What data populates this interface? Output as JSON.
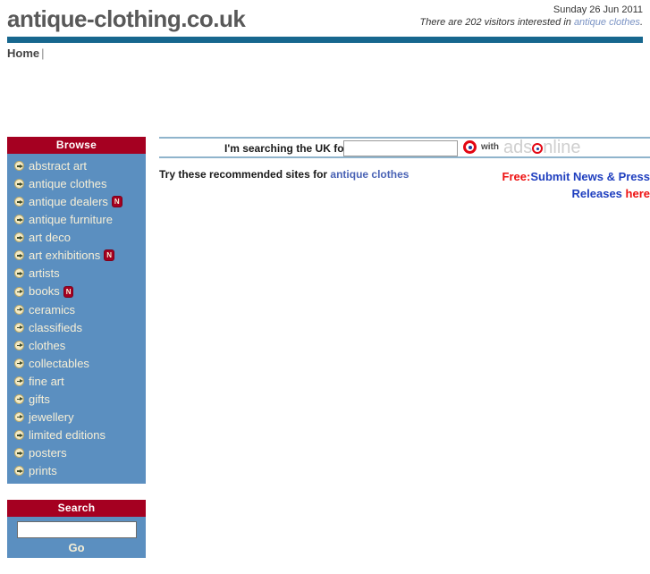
{
  "header": {
    "site_title": "antique-clothing.co.uk",
    "date": "Sunday 26 Jun 2011",
    "visitors_prefix": "There are 202 visitors interested in ",
    "visitors_link": "antique clothes",
    "visitors_suffix": ".",
    "nav": {
      "home_label": "Home",
      "separator": "|"
    }
  },
  "sidebar": {
    "browse": {
      "title": "Browse",
      "items": [
        {
          "label": "abstract art",
          "new": false
        },
        {
          "label": "antique clothes",
          "new": false
        },
        {
          "label": "antique dealers",
          "new": true
        },
        {
          "label": "antique furniture",
          "new": false
        },
        {
          "label": "art deco",
          "new": false
        },
        {
          "label": "art exhibitions",
          "new": true
        },
        {
          "label": "artists",
          "new": false
        },
        {
          "label": "books",
          "new": true
        },
        {
          "label": "ceramics",
          "new": false
        },
        {
          "label": "classifieds",
          "new": false
        },
        {
          "label": "clothes",
          "new": false
        },
        {
          "label": "collectables",
          "new": false
        },
        {
          "label": "fine art",
          "new": false
        },
        {
          "label": "gifts",
          "new": false
        },
        {
          "label": "jewellery",
          "new": false
        },
        {
          "label": "limited editions",
          "new": false
        },
        {
          "label": "posters",
          "new": false
        },
        {
          "label": "prints",
          "new": false
        }
      ],
      "new_badge_label": "N"
    },
    "search": {
      "title": "Search",
      "input_value": "",
      "input_placeholder": "",
      "go_label": "Go"
    }
  },
  "main": {
    "uk_search": {
      "label": "I'm searching the UK for...",
      "input_value": "",
      "input_placeholder": "",
      "with_label": "with",
      "logo_before": "ads",
      "logo_after": "nline"
    },
    "recommend": {
      "text": "Try these recommended sites for ",
      "link": "antique clothes"
    },
    "press_promo": {
      "free_label": "Free:",
      "line1": "Submit News & Press",
      "line2": "Releases ",
      "here_label": "here"
    }
  },
  "colors": {
    "panel_head": "#A50021",
    "panel_body": "#5B8FC0",
    "title_rule": "#17678E",
    "accent_red": "#EE1111",
    "accent_blue": "#1F3FBF"
  }
}
